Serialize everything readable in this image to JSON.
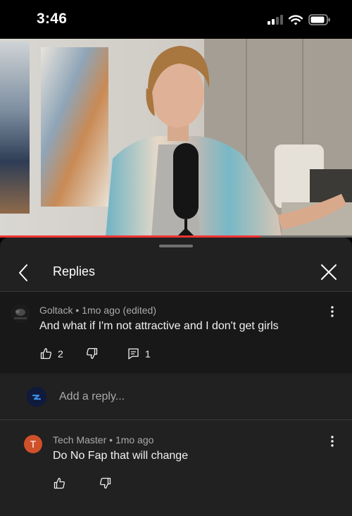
{
  "status_bar": {
    "time": "3:46",
    "icons": [
      "signal-icon",
      "wifi-icon",
      "battery-icon"
    ]
  },
  "video": {
    "progress_fraction": 0.74
  },
  "replies_panel": {
    "title": "Replies",
    "back_icon": "chevron-left-icon",
    "close_icon": "close-icon"
  },
  "parent_comment": {
    "author": "Goltack",
    "time": "1mo ago (edited)",
    "text": "And what if I'm not attractive and I don't get girls",
    "likes": "2",
    "replies": "1"
  },
  "reply_input": {
    "placeholder": "Add a reply..."
  },
  "reply": {
    "avatar_letter": "T",
    "author": "Tech Master",
    "time": "1mo ago",
    "text": "Do No Fap that will change"
  },
  "colors": {
    "sheet_bg": "#212121",
    "parent_bg": "#181818",
    "progress": "#f03333",
    "reply_avatar": "#d0502a"
  }
}
